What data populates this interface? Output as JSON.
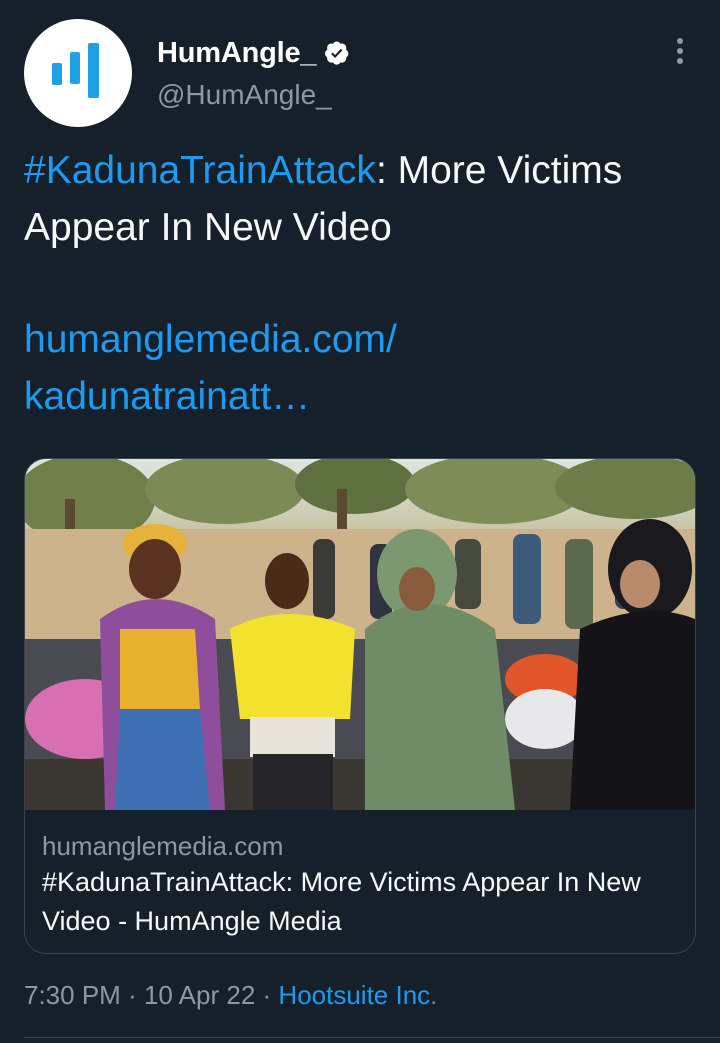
{
  "tweet": {
    "display_name": "HumAngle_",
    "handle": "@HumAngle_",
    "text_tag": "#KadunaTrainAttack",
    "text_rest": ": More Victims Appear In New Video",
    "link_line1": "humanglemedia.com/",
    "link_line2": "kadunatrainatt…",
    "time": "7:30 PM",
    "separator": "·",
    "date": "10 Apr 22",
    "source": "Hootsuite Inc."
  },
  "card": {
    "domain": "humanglemedia.com",
    "title": "#KadunaTrainAttack: More Victims Appear In New Video - HumAngle Media"
  },
  "icons": {
    "avatar": "humangle-logo-icon",
    "verified": "verified-badge-icon",
    "more": "more-vertical-icon"
  },
  "colors": {
    "background": "#15202b",
    "accent": "#1d9bf0",
    "secondary_text": "#8b98a5",
    "border": "#38444d"
  }
}
